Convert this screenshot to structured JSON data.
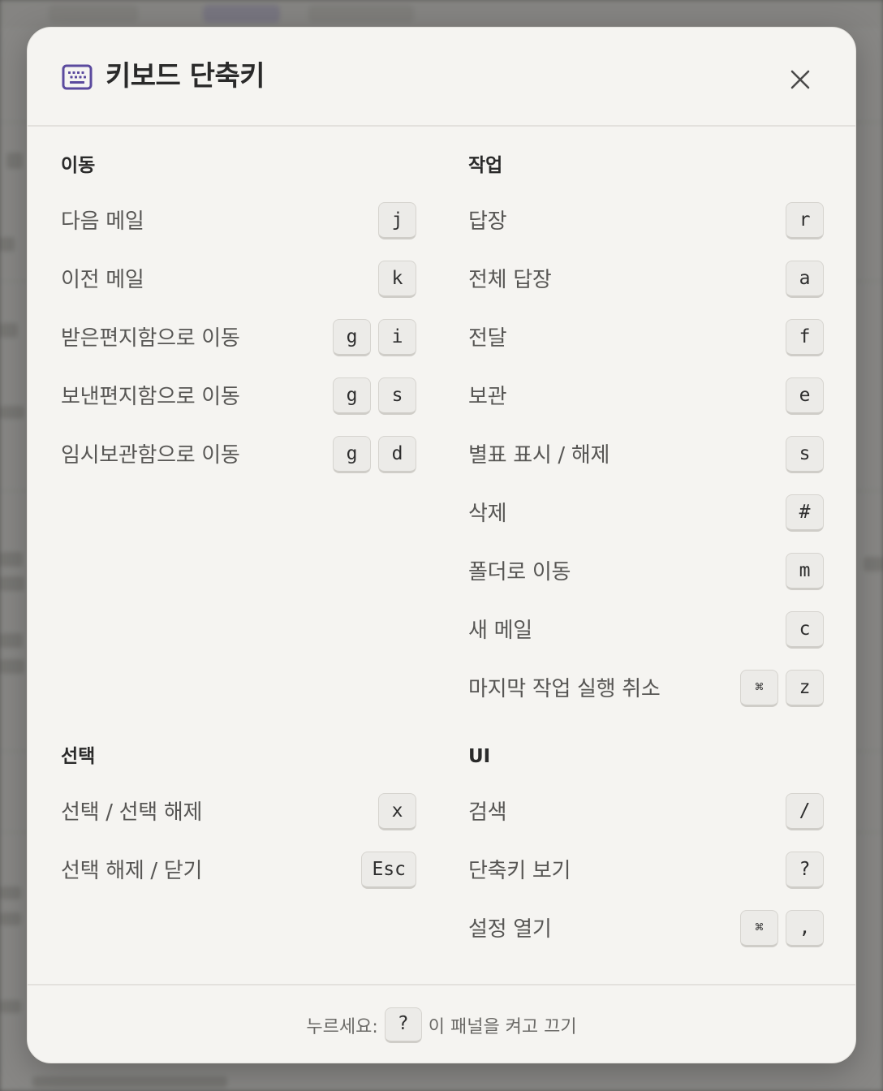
{
  "modal": {
    "title": "키보드 단축키",
    "close_icon": "close-icon",
    "header_icon": "keyboard-icon"
  },
  "sections": {
    "navigation": {
      "title": "이동",
      "items": [
        {
          "label": "다음 메일",
          "keys": [
            "j"
          ]
        },
        {
          "label": "이전 메일",
          "keys": [
            "k"
          ]
        },
        {
          "label": "받은편지함으로 이동",
          "keys": [
            "g",
            "i"
          ]
        },
        {
          "label": "보낸편지함으로 이동",
          "keys": [
            "g",
            "s"
          ]
        },
        {
          "label": "임시보관함으로 이동",
          "keys": [
            "g",
            "d"
          ]
        }
      ]
    },
    "actions": {
      "title": "작업",
      "items": [
        {
          "label": "답장",
          "keys": [
            "r"
          ]
        },
        {
          "label": "전체 답장",
          "keys": [
            "a"
          ]
        },
        {
          "label": "전달",
          "keys": [
            "f"
          ]
        },
        {
          "label": "보관",
          "keys": [
            "e"
          ]
        },
        {
          "label": "별표 표시 / 해제",
          "keys": [
            "s"
          ]
        },
        {
          "label": "삭제",
          "keys": [
            "#"
          ]
        },
        {
          "label": "폴더로 이동",
          "keys": [
            "m"
          ]
        },
        {
          "label": "새 메일",
          "keys": [
            "c"
          ]
        },
        {
          "label": "마지막 작업 실행 취소",
          "keys": [
            "⌘",
            "z"
          ]
        }
      ]
    },
    "selection": {
      "title": "선택",
      "items": [
        {
          "label": "선택 / 선택 해제",
          "keys": [
            "x"
          ]
        },
        {
          "label": "선택 해제 / 닫기",
          "keys": [
            "Esc"
          ]
        }
      ]
    },
    "ui": {
      "title": "UI",
      "items": [
        {
          "label": "검색",
          "keys": [
            "/"
          ]
        },
        {
          "label": "단축키 보기",
          "keys": [
            "?"
          ]
        },
        {
          "label": "설정 열기",
          "keys": [
            "⌘",
            ","
          ]
        }
      ]
    }
  },
  "footer": {
    "prefix": "누르세요:",
    "key": "?",
    "suffix": "이 패널을 켜고 끄기"
  },
  "colors": {
    "accent_icon": "#5b4a9e",
    "modal_bg": "#f5f4f1",
    "key_bg": "#ecebe8"
  }
}
